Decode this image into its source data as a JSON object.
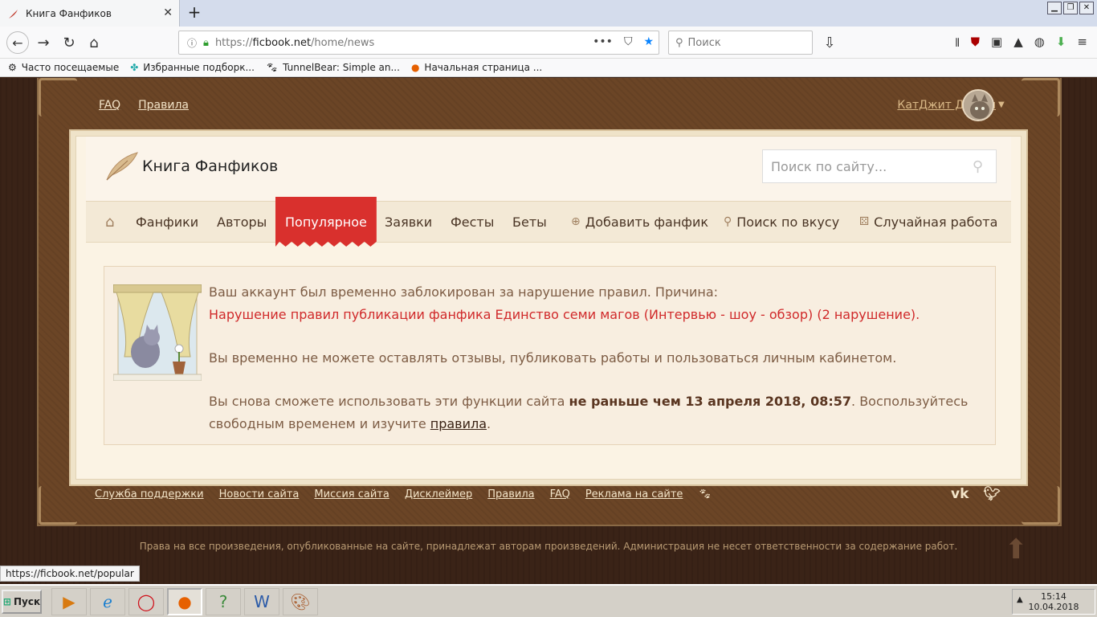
{
  "browser": {
    "tab_title": "Книга Фанфиков",
    "url_protocol": "https://",
    "url_host": "ficbook.net",
    "url_path": "/home/news",
    "search_placeholder": "Поиск"
  },
  "bookmarks": [
    {
      "label": "Часто посещаемые",
      "icon": "gear-icon"
    },
    {
      "label": "Избранные подборк...",
      "icon": "puzzle-icon"
    },
    {
      "label": "TunnelBear: Simple an...",
      "icon": "bear-icon"
    },
    {
      "label": "Начальная страница ...",
      "icon": "firefox-icon"
    }
  ],
  "site": {
    "top_links": [
      "FAQ",
      "Правила"
    ],
    "username": "КатДжит ДжоАл",
    "logo_title": "Книга Фанфиков",
    "search_placeholder": "Поиск по сайту...",
    "menu": [
      "Фанфики",
      "Авторы",
      "Популярное",
      "Заявки",
      "Фесты",
      "Беты"
    ],
    "menu_active": "Популярное",
    "menu_extra": [
      "Добавить фанфик",
      "Поиск по вкусу",
      "Случайная работа"
    ]
  },
  "notice": {
    "line1": "Ваш аккаунт был временно заблокирован за нарушение правил. Причина:",
    "reason": "Нарушение правил публикации фанфика Единство семи магов (Интервью - шоу - обзор) (2 нарушение).",
    "line3": "Вы временно не можете оставлять отзывы, публиковать работы и пользоваться личным кабинетом.",
    "line4_pre": "Вы снова сможете использовать эти функции сайта ",
    "line4_bold": "не раньше чем 13 апреля 2018, 08:57",
    "line4_post": ". Воспользуйтесь свободным временем и изучите ",
    "rules_link": "правила",
    "end": "."
  },
  "footer": {
    "links": [
      "Служба поддержки",
      "Новости сайта",
      "Миссия сайта",
      "Дисклеймер",
      "Правила",
      "FAQ",
      "Реклама на сайте"
    ],
    "copyright": "Права на все произведения, опубликованные на сайте, принадлежат авторам произведений. Администрация не несет ответственности за содержание работ."
  },
  "status_url": "https://ficbook.net/popular",
  "taskbar": {
    "start_label": "Пуск",
    "time": "15:14",
    "date": "10.04.2018"
  },
  "colors": {
    "menu_active": "#d9302d",
    "reason_text": "#d0292a",
    "frame_brown": "#6b4526"
  }
}
